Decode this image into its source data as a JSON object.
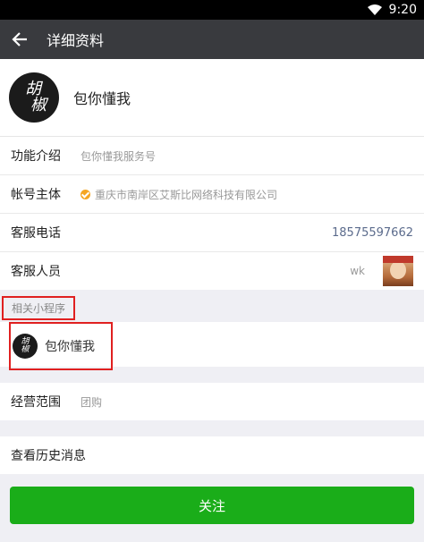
{
  "statusbar": {
    "time": "9:20",
    "wifi_icon": "wifi-icon"
  },
  "appbar": {
    "title": "详细资料",
    "back_icon": "arrow-left-icon"
  },
  "profile": {
    "logo_text_1": "胡",
    "logo_text_2": "椒",
    "name": "包你懂我"
  },
  "info": {
    "intro_label": "功能介绍",
    "intro_value": "包你懂我服务号",
    "entity_label": "帐号主体",
    "entity_value": "重庆市南岸区艾斯比网络科技有限公司",
    "phone_label": "客服电话",
    "phone_value": "18575597662",
    "staff_label": "客服人员",
    "staff_value": "wk"
  },
  "miniprograms": {
    "header": "相关小程序",
    "items": [
      {
        "logo_text_1": "胡",
        "logo_text_2": "椒",
        "name": "包你懂我"
      }
    ]
  },
  "business": {
    "label": "经营范围",
    "value": "团购"
  },
  "history": {
    "label": "查看历史消息"
  },
  "follow_button": {
    "label": "关注"
  },
  "colors": {
    "accent": "#1aad19",
    "appbar": "#393a3e",
    "highlight": "#e02020"
  }
}
